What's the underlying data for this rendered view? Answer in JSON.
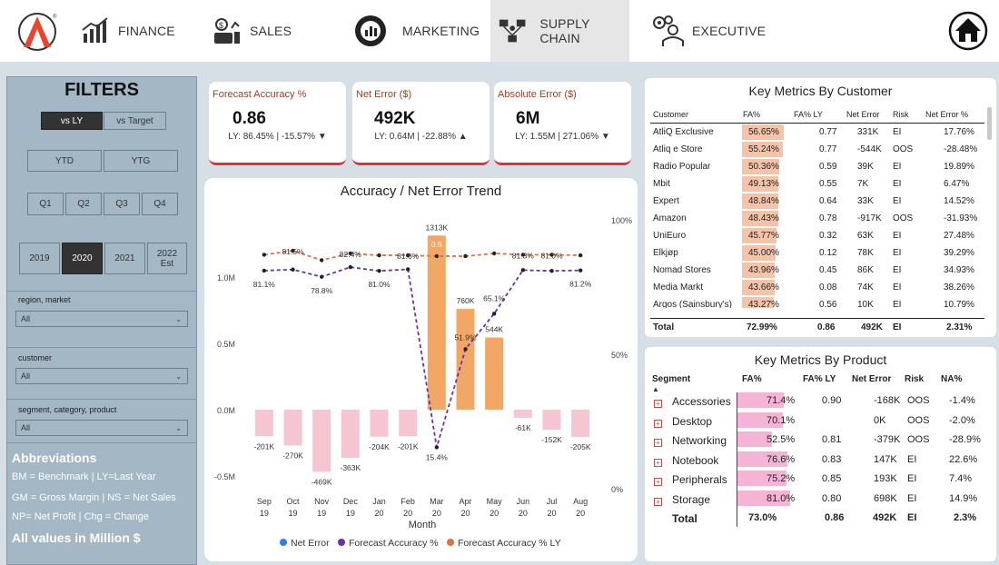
{
  "nav": {
    "items": [
      {
        "label": "FINANCE"
      },
      {
        "label": "SALES"
      },
      {
        "label": "MARKETING"
      },
      {
        "label": "SUPPLY CHAIN"
      },
      {
        "label": "EXECUTIVE"
      }
    ],
    "active": "SUPPLY CHAIN",
    "logo_icon": "atliq-logo-icon",
    "home_icon": "home-icon"
  },
  "filters": {
    "title": "FILTERS",
    "compare": [
      "vs LY",
      "vs Target"
    ],
    "period": [
      "YTD",
      "YTG"
    ],
    "quarters": [
      "Q1",
      "Q2",
      "Q3",
      "Q4"
    ],
    "years": [
      "2019",
      "2020",
      "2021",
      "2022 Est"
    ],
    "selected_compare": "vs LY",
    "selected_year": "2020",
    "region_label": "region, market",
    "region_value": "All",
    "customer_label": "customer",
    "customer_value": "All",
    "segment_label": "segment, category, product",
    "segment_value": "All"
  },
  "abbreviations": {
    "title": "Abbreviations",
    "line1": "BM = Benchmark | LY=Last Year",
    "line2": "GM = Gross Margin | NS = Net Sales",
    "line3": "NP= Net Profit | Chg = Change",
    "note": "All values in Million $"
  },
  "kpis": [
    {
      "title": "Forecast Accuracy %",
      "value": "0.86",
      "sub": "LY: 86.45% | -15.57%",
      "trend": "▼"
    },
    {
      "title": "Net Error ($)",
      "value": "492K",
      "sub": "LY: 0.64M | -22.88%",
      "trend": "▲"
    },
    {
      "title": "Absolute Error ($)",
      "value": "6M",
      "sub": "LY: 1.55M | 271.06%",
      "trend": "▼"
    }
  ],
  "chart_data": {
    "type": "bar",
    "title": "Accuracy / Net Error Trend",
    "xlabel": "Month",
    "categories": [
      "Sep 19",
      "Oct 19",
      "Nov 19",
      "Dec 19",
      "Jan 20",
      "Feb 20",
      "Mar 20",
      "Apr 20",
      "May 20",
      "Jun 20",
      "Jul 20",
      "Aug 20"
    ],
    "series": [
      {
        "name": "Net Error",
        "type": "bar",
        "axis": "left",
        "values": [
          -201000,
          -270000,
          -469000,
          -363000,
          -204000,
          -201000,
          1313000,
          760000,
          544000,
          -61000,
          -152000,
          -205000
        ],
        "labels": [
          "-201K",
          "-270K",
          "-469K",
          "-363K",
          "-204K",
          "-201K",
          "1313K",
          "760K",
          "544K",
          "-61K",
          "-152K",
          "-205K"
        ]
      },
      {
        "name": "Forecast Accuracy %",
        "type": "line",
        "axis": "right",
        "values": [
          81.1,
          81.5,
          78.8,
          82.4,
          81.0,
          81.6,
          15.4,
          51.9,
          65.1,
          81.3,
          81.0,
          81.2
        ],
        "labels": [
          "81.1%",
          "",
          "78.8%",
          "",
          "81.0%",
          "",
          "15.4%",
          "51.9%",
          "65.1%",
          "",
          "",
          "81.2%"
        ]
      },
      {
        "name": "Forecast Accuracy % LY",
        "type": "line",
        "axis": "right",
        "values": [
          87.0,
          88.5,
          85.0,
          87.5,
          86.8,
          86.8,
          86.5,
          86.5,
          87.5,
          87.0,
          87.0,
          86.8
        ],
        "labels": [
          "",
          "81.5%",
          "",
          "82.4%",
          "",
          "81.6%",
          "0.9",
          "",
          "",
          "81.3%",
          "81.0%",
          ""
        ]
      }
    ],
    "left_ticks": [
      "1.0M",
      "0.5M",
      "0.0M",
      "-0.5M"
    ],
    "right_ticks": [
      "100%",
      "50%",
      "0%"
    ],
    "ylim_left": [
      -0.6,
      1.4
    ],
    "ylim_right": [
      0,
      100
    ],
    "colors": {
      "net_error_pos": "#f2a864",
      "net_error_neg": "#f5c6d2",
      "accuracy": "#7030a0",
      "accuracy_ly": "#e8703a",
      "legend_net": "#2f7fe8"
    }
  },
  "customers": {
    "title": "Key Metrics By Customer",
    "headers": [
      "Customer",
      "FA%",
      "FA% LY",
      "Net Error",
      "Risk",
      "Net Error %"
    ],
    "rows": [
      {
        "name": "AtliQ Exclusive",
        "fa": "56.65%",
        "fa_num": 56.65,
        "faly": "0.77",
        "ne": "331K",
        "risk": "EI",
        "nep": "17.76%"
      },
      {
        "name": "Atliq e Store",
        "fa": "55.24%",
        "fa_num": 55.24,
        "faly": "0.77",
        "ne": "-544K",
        "risk": "OOS",
        "nep": "-28.48%"
      },
      {
        "name": "Radio Popular",
        "fa": "50.36%",
        "fa_num": 50.36,
        "faly": "0.59",
        "ne": "39K",
        "risk": "EI",
        "nep": "19.89%"
      },
      {
        "name": "Mbit",
        "fa": "49.13%",
        "fa_num": 49.13,
        "faly": "0.55",
        "ne": "7K",
        "risk": "EI",
        "nep": "6.47%"
      },
      {
        "name": "Expert",
        "fa": "48.84%",
        "fa_num": 48.84,
        "faly": "0.64",
        "ne": "33K",
        "risk": "EI",
        "nep": "14.52%"
      },
      {
        "name": "Amazon",
        "fa": "48.43%",
        "fa_num": 48.43,
        "faly": "0.78",
        "ne": "-917K",
        "risk": "OOS",
        "nep": "-31.93%"
      },
      {
        "name": "UniEuro",
        "fa": "45.77%",
        "fa_num": 45.77,
        "faly": "0.32",
        "ne": "63K",
        "risk": "EI",
        "nep": "27.48%"
      },
      {
        "name": "Elkjøp",
        "fa": "45.00%",
        "fa_num": 45.0,
        "faly": "0.12",
        "ne": "78K",
        "risk": "EI",
        "nep": "39.29%"
      },
      {
        "name": "Nomad Stores",
        "fa": "43.96%",
        "fa_num": 43.96,
        "faly": "0.45",
        "ne": "86K",
        "risk": "EI",
        "nep": "34.93%"
      },
      {
        "name": "Media Markt",
        "fa": "43.66%",
        "fa_num": 43.66,
        "faly": "0.08",
        "ne": "74K",
        "risk": "EI",
        "nep": "38.26%"
      },
      {
        "name": "Argos (Sainsbury's)",
        "fa": "43.27%",
        "fa_num": 43.27,
        "faly": "0.56",
        "ne": "10K",
        "risk": "EI",
        "nep": "10.79%"
      }
    ],
    "total": {
      "name": "Total",
      "fa": "72.99%",
      "faly": "0.86",
      "ne": "492K",
      "risk": "EI",
      "nep": "2.31%"
    }
  },
  "products": {
    "title": "Key Metrics By Product",
    "headers": [
      "Segment",
      "FA%",
      "FA% LY",
      "Net Error",
      "Risk",
      "NA%"
    ],
    "rows": [
      {
        "name": "Accessories",
        "fa": "71.4%",
        "fa_num": 71.4,
        "faly": "0.90",
        "ne": "-168K",
        "risk": "OOS",
        "na": "-1.4%"
      },
      {
        "name": "Desktop",
        "fa": "70.1%",
        "fa_num": 70.1,
        "faly": "",
        "ne": "0K",
        "risk": "OOS",
        "na": "-2.0%"
      },
      {
        "name": "Networking",
        "fa": "52.5%",
        "fa_num": 52.5,
        "faly": "0.81",
        "ne": "-379K",
        "risk": "OOS",
        "na": "-28.9%"
      },
      {
        "name": "Notebook",
        "fa": "76.6%",
        "fa_num": 76.6,
        "faly": "0.83",
        "ne": "147K",
        "risk": "EI",
        "na": "22.6%"
      },
      {
        "name": "Peripherals",
        "fa": "75.2%",
        "fa_num": 75.2,
        "faly": "0.85",
        "ne": "193K",
        "risk": "EI",
        "na": "7.4%"
      },
      {
        "name": "Storage",
        "fa": "81.0%",
        "fa_num": 81.0,
        "faly": "0.80",
        "ne": "698K",
        "risk": "EI",
        "na": "14.9%"
      }
    ],
    "total": {
      "name": "Total",
      "fa": "73.0%",
      "faly": "0.86",
      "ne": "492K",
      "risk": "EI",
      "na": "2.3%"
    }
  }
}
